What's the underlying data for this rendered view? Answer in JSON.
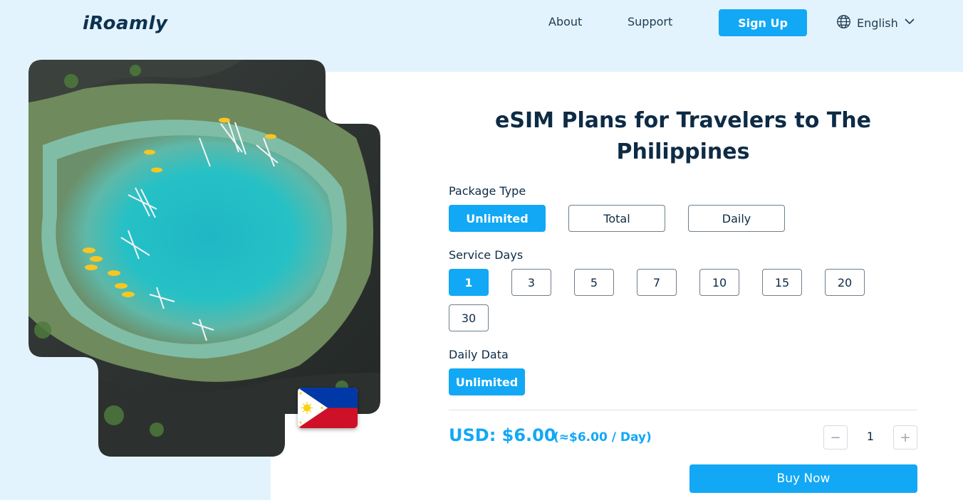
{
  "header": {
    "logo": "iRoamly",
    "nav": [
      {
        "label": "About"
      },
      {
        "label": "Support"
      }
    ],
    "signup_label": "Sign Up",
    "language": "English",
    "accent_color": "#12a8f5"
  },
  "main": {
    "title": "eSIM Plans for Travelers to The Philippines",
    "package_type": {
      "label": "Package Type",
      "options": [
        "Unlimited",
        "Total",
        "Daily"
      ],
      "selected": "Unlimited"
    },
    "service_days": {
      "label": "Service Days",
      "options": [
        "1",
        "3",
        "5",
        "7",
        "10",
        "15",
        "20",
        "30"
      ],
      "selected": "1"
    },
    "daily_data": {
      "label": "Daily Data",
      "options": [
        "Unlimited"
      ],
      "selected": "Unlimited"
    },
    "price": "USD: $6.00",
    "per_day": "(≈$6.00 / Day)",
    "quantity": "1",
    "minus": "−",
    "plus": "+",
    "buy_label": "Buy Now"
  },
  "icons": {
    "language": "globe-icon",
    "dropdown": "chevron-down-icon",
    "flag": "philippines-flag-icon"
  }
}
